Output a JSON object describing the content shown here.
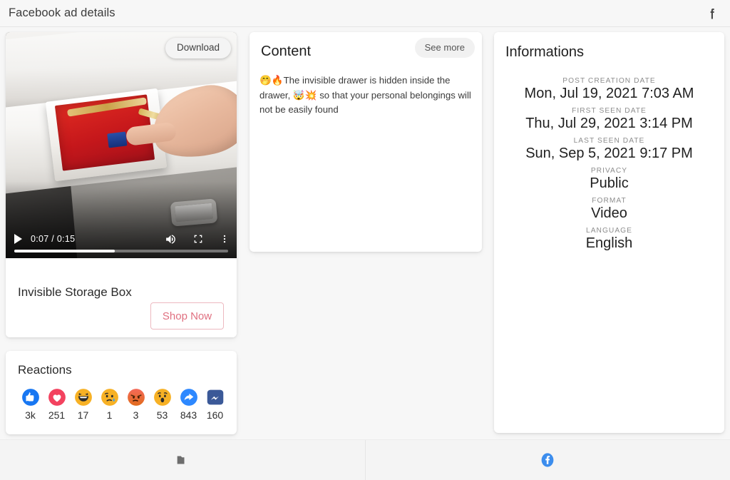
{
  "header": {
    "title": "Facebook ad details",
    "facebook_icon": "facebook-f-icon"
  },
  "ad": {
    "download_label": "Download",
    "title": "Invisible Storage Box",
    "cta_label": "Shop Now",
    "cta_color": "#e07080",
    "video": {
      "current_time": "0:07",
      "duration": "0:15",
      "time_display": "0:07 / 0:15",
      "progress_percent": 47,
      "play_icon": "play-icon",
      "volume_icon": "volume-icon",
      "fullscreen_icon": "fullscreen-icon",
      "more_icon": "more-vertical-icon"
    }
  },
  "reactions": {
    "title": "Reactions",
    "items": [
      {
        "name": "like",
        "icon": "thumbs-up-icon",
        "count": "3k",
        "color": "#1877f2"
      },
      {
        "name": "love",
        "icon": "heart-icon",
        "count": "251",
        "color": "#f3425f"
      },
      {
        "name": "haha",
        "icon": "haha-icon",
        "count": "17",
        "color": "#f7b125"
      },
      {
        "name": "sad",
        "icon": "sad-icon",
        "count": "1",
        "color": "#f7b125"
      },
      {
        "name": "angry",
        "icon": "angry-icon",
        "count": "3",
        "color": "#e9710f"
      },
      {
        "name": "wow",
        "icon": "wow-icon",
        "count": "53",
        "color": "#f7b125"
      },
      {
        "name": "share",
        "icon": "share-icon",
        "count": "843",
        "color": "#2d88ff"
      },
      {
        "name": "messenger",
        "icon": "messenger-icon",
        "count": "160",
        "color": "#3b5998"
      }
    ]
  },
  "content": {
    "title": "Content",
    "see_more_label": "See more",
    "emoji_1": "🤭",
    "emoji_2": "🔥",
    "emoji_3": "🤯",
    "emoji_4": "💥",
    "text_part_1": "The invisible drawer is hidden inside the drawer,",
    "text_part_2": " so that your personal belongings will not be easily found",
    "full_text": "🤭🔥The invisible drawer is hidden inside the drawer, 🤯💥 so that your personal belongings will not be easily found"
  },
  "informations": {
    "title": "Informations",
    "fields": [
      {
        "label": "POST CREATION DATE",
        "value": "Mon, Jul 19, 2021 7:03 AM"
      },
      {
        "label": "FIRST SEEN DATE",
        "value": "Thu, Jul 29, 2021 3:14 PM"
      },
      {
        "label": "LAST SEEN DATE",
        "value": "Sun, Sep 5, 2021 9:17 PM"
      },
      {
        "label": "PRIVACY",
        "value": "Public"
      },
      {
        "label": "FORMAT",
        "value": "Video"
      },
      {
        "label": "LANGUAGE",
        "value": "English"
      }
    ]
  },
  "bottombar": {
    "items": [
      {
        "icon": "folder-icon",
        "color": "#6d6d6d"
      },
      {
        "icon": "facebook-icon",
        "color": "#3c8ded"
      }
    ]
  }
}
